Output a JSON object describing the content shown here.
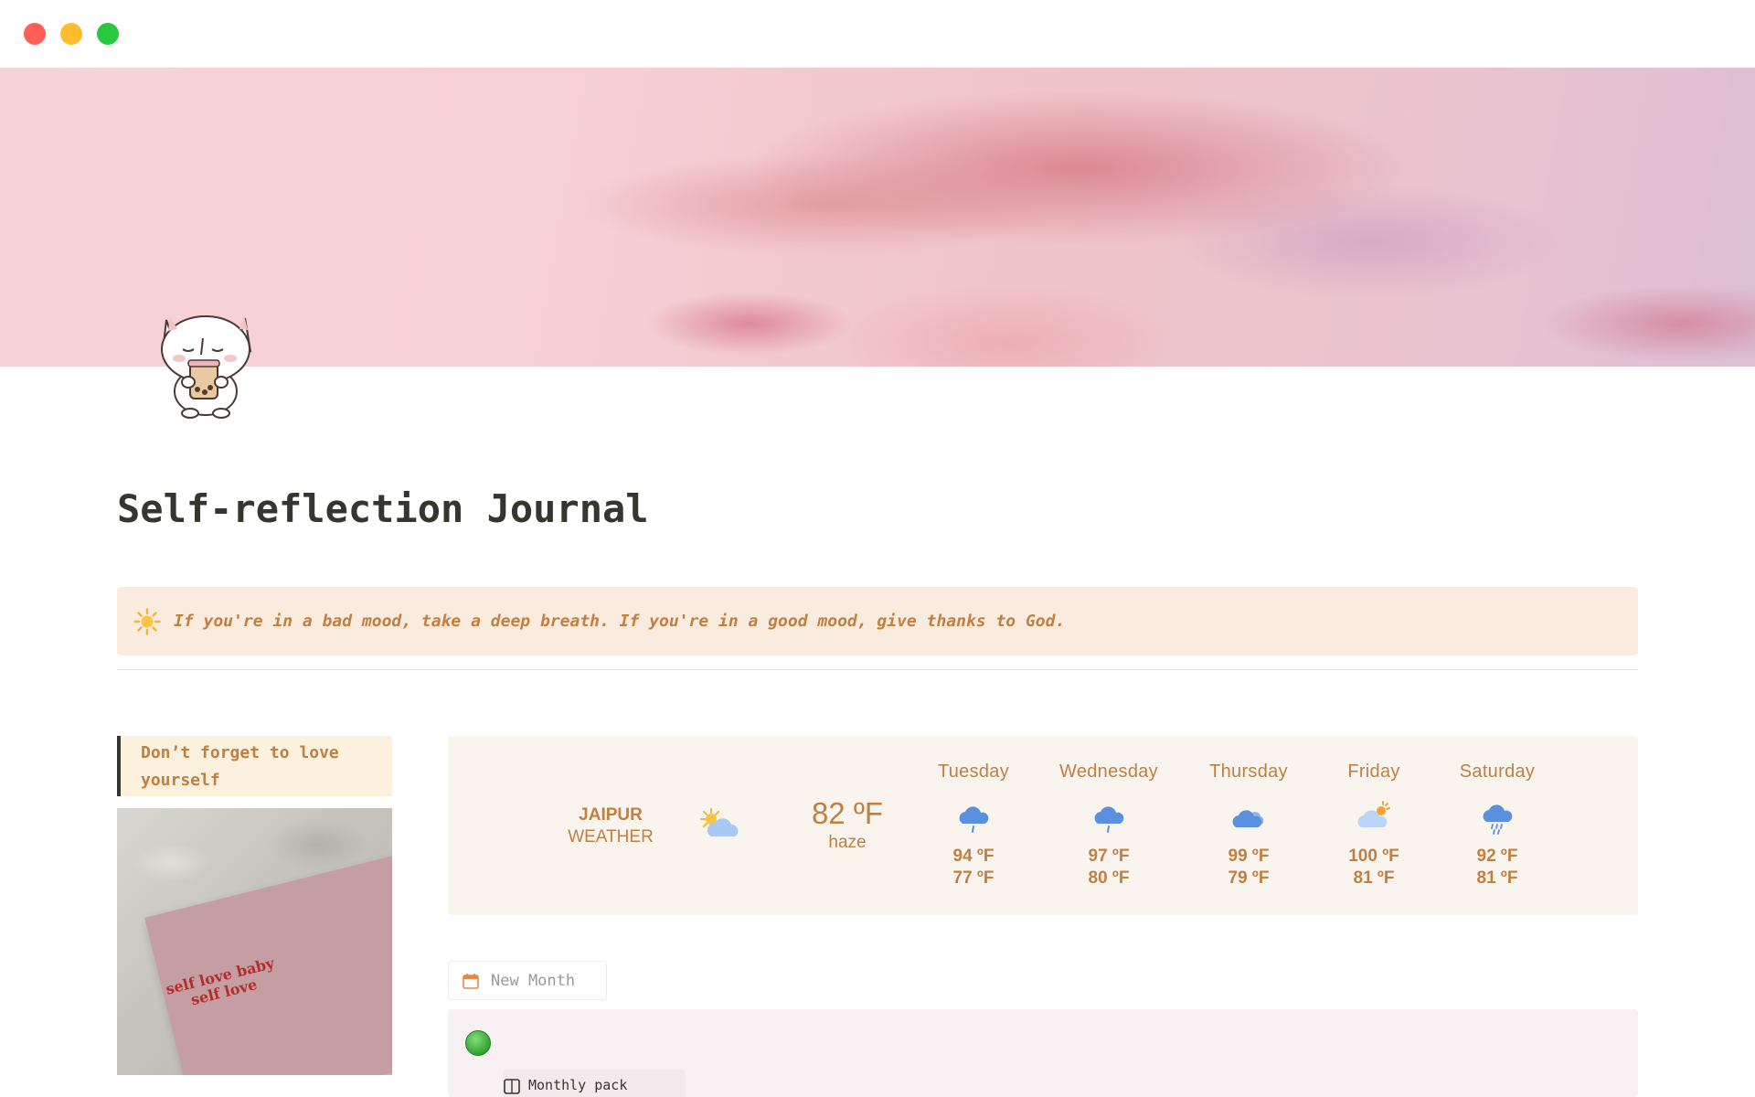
{
  "page": {
    "title": "Self-reflection Journal",
    "icon": "cat-drinking-boba-icon",
    "cover": "pink-sky-clouds-cover"
  },
  "callout": {
    "icon": "sun-icon",
    "text": "If you're in a bad mood, take a deep breath. If you're in a good mood, give thanks to God."
  },
  "left_column": {
    "quote_line1": "Don’t forget to love",
    "quote_line2": "yourself",
    "image_text_line1": "self love baby",
    "image_text_line2": "self love"
  },
  "weather": {
    "city": "JAIPUR",
    "label": "WEATHER",
    "current_icon": "sun-behind-cloud-icon",
    "current_temp": "82 ºF",
    "current_condition": "haze",
    "days": [
      {
        "name": "Tuesday",
        "icon": "rain-cloud-icon",
        "high": "94 ºF",
        "low": "77 ºF"
      },
      {
        "name": "Wednesday",
        "icon": "rain-cloud-icon",
        "high": "97 ºF",
        "low": "80 ºF"
      },
      {
        "name": "Thursday",
        "icon": "cloudy-icon",
        "high": "99 ºF",
        "low": "79 ºF"
      },
      {
        "name": "Friday",
        "icon": "partly-sunny-icon",
        "high": "100 ºF",
        "low": "81 ºF"
      },
      {
        "name": "Saturday",
        "icon": "heavy-rain-cloud-icon",
        "high": "92 ºF",
        "low": "81 ºF"
      }
    ]
  },
  "database": {
    "new_button_label": "New Month",
    "group_icon": "green-circle-icon",
    "first_item_label": "Monthly pack"
  },
  "colors": {
    "accent_text": "#c27f3f",
    "callout_bg": "#f9ebdd",
    "weather_bg": "#faf4ef",
    "board_bg": "#f8f1f3"
  }
}
